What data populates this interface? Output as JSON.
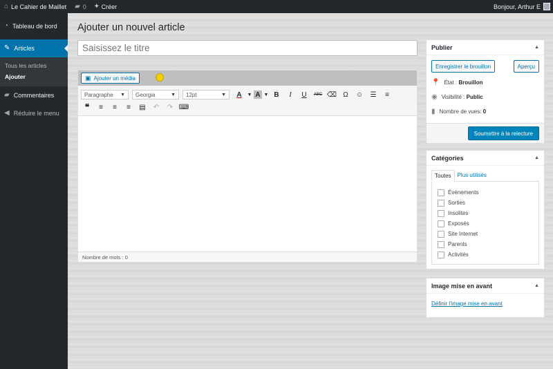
{
  "adminbar": {
    "site_name": "Le Cahier de Maillet",
    "comments_count": "0",
    "new_label": "Créer",
    "greeting": "Bonjour, Arthur E"
  },
  "sidebar": {
    "dashboard": "Tableau de bord",
    "posts": "Articles",
    "sub_all": "Tous les articles",
    "sub_add": "Ajouter",
    "comments": "Commentaires",
    "collapse": "Réduire le menu"
  },
  "page": {
    "title": "Ajouter un nouvel article",
    "title_placeholder": "Saisissez le titre"
  },
  "editor": {
    "add_media": "Ajouter un média",
    "format_select": "Paragraphe",
    "font_select": "Georgia",
    "size_select": "12pt",
    "word_count": "Nombre de mots : 0"
  },
  "publish": {
    "header": "Publier",
    "save_draft": "Enregistrer le brouillon",
    "preview": "Aperçu",
    "state_label": "État : ",
    "state_value": "Brouillon",
    "visibility_label": "Visibilité : ",
    "visibility_value": "Public",
    "views_label": "Nombre de vues: ",
    "views_value": "0",
    "submit": "Soumettre à la relecture"
  },
  "categories": {
    "header": "Catégories",
    "tab_all": "Toutes",
    "tab_popular": "Plus utilisés",
    "items": [
      "Événements",
      "Sorties",
      "Insolites",
      "Exposés",
      "Site Internet",
      "Parents",
      "Activités"
    ]
  },
  "featured_image": {
    "header": "Image mise en avant",
    "link": "Définir l’image mise en avant"
  }
}
